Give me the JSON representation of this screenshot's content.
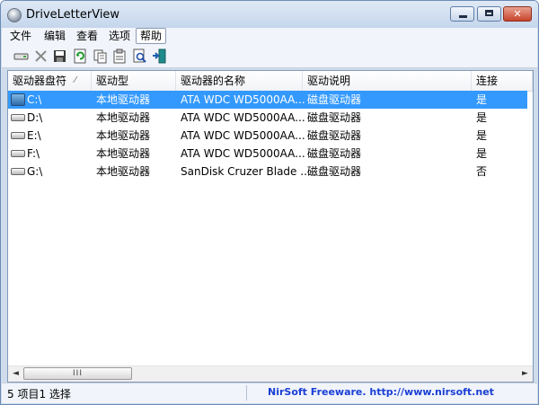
{
  "window": {
    "title": "DriveLetterView"
  },
  "window_controls": {
    "minimize": "–",
    "maximize": "□",
    "close": "✕"
  },
  "menu": [
    "文件",
    "编辑",
    "查看",
    "选项",
    "帮助"
  ],
  "toolbar_icons": [
    "drive-icon",
    "delete-x-icon",
    "save-icon",
    "refresh-icon",
    "copy-icon",
    "properties-icon",
    "find-icon",
    "exit-icon"
  ],
  "columns": [
    "驱动器盘符",
    "驱动型",
    "驱动器的名称",
    "驱动说明",
    "连接"
  ],
  "rows": [
    {
      "letter": "C:\\",
      "type": "本地驱动器",
      "name": "ATA WDC WD5000AA...",
      "desc": "磁盘驱动器",
      "connected": "是",
      "selected": true
    },
    {
      "letter": "D:\\",
      "type": "本地驱动器",
      "name": "ATA WDC WD5000AA...",
      "desc": "磁盘驱动器",
      "connected": "是",
      "selected": false
    },
    {
      "letter": "E:\\",
      "type": "本地驱动器",
      "name": "ATA WDC WD5000AA...",
      "desc": "磁盘驱动器",
      "connected": "是",
      "selected": false
    },
    {
      "letter": "F:\\",
      "type": "本地驱动器",
      "name": "ATA WDC WD5000AA...",
      "desc": "磁盘驱动器",
      "connected": "是",
      "selected": false
    },
    {
      "letter": "G:\\",
      "type": "本地驱动器",
      "name": "SanDisk Cruzer Blade ...",
      "desc": "磁盘驱动器",
      "connected": "否",
      "selected": false
    }
  ],
  "scrollbar": {
    "left_arrow": "◄",
    "right_arrow": "►",
    "grip": "III"
  },
  "status": {
    "items": "5 项目1 选择",
    "link": "NirSoft Freeware.  http://www.nirsoft.net"
  }
}
